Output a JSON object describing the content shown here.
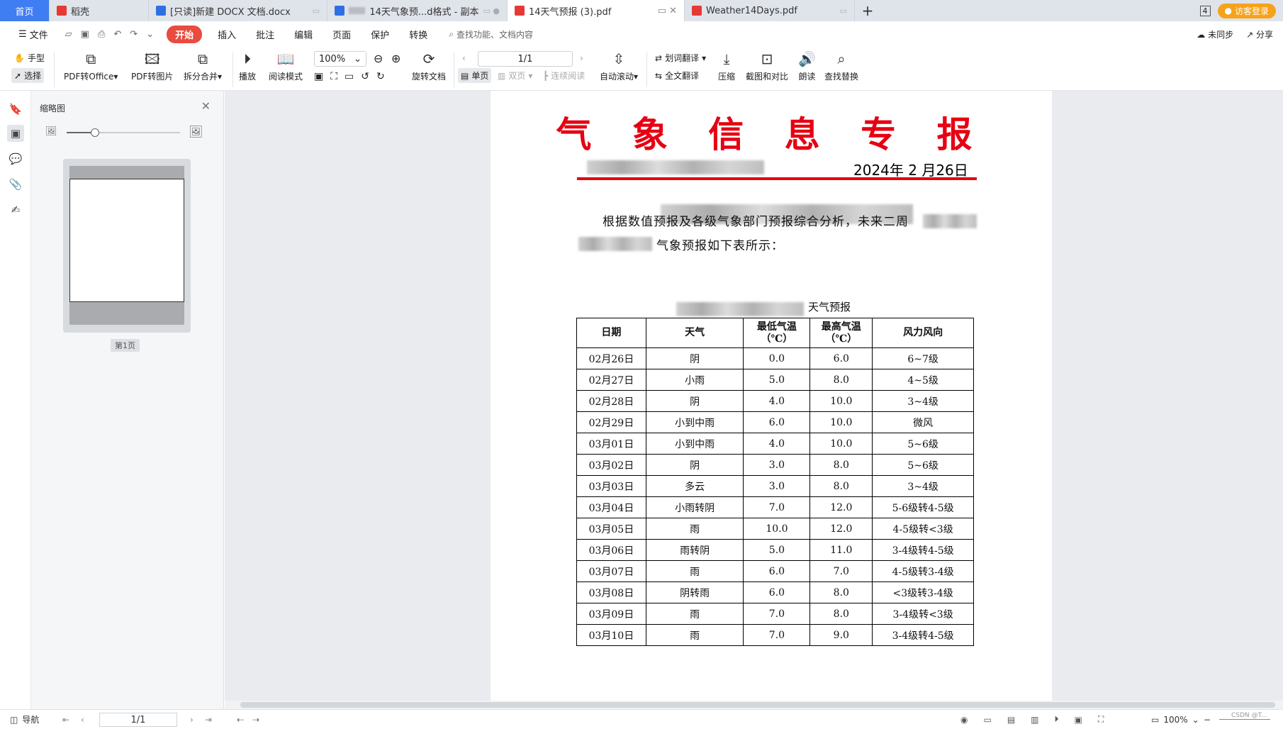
{
  "tabs": [
    {
      "label": "首页"
    },
    {
      "label": "稻壳"
    },
    {
      "label": "[只读]新建 DOCX 文档.docx"
    },
    {
      "label": "14天气象预...d格式 - 副本"
    },
    {
      "label": "14天气预报 (3).pdf"
    },
    {
      "label": "Weather14Days.pdf"
    }
  ],
  "tab_right": {
    "window_count": "4",
    "visitor_label": "访客登录"
  },
  "menu": {
    "file": "文件",
    "items": [
      "开始",
      "插入",
      "批注",
      "编辑",
      "页面",
      "保护",
      "转换"
    ],
    "search_placeholder": "查找功能、文档内容",
    "sync": "未同步",
    "share": "分享"
  },
  "toolbar": {
    "hand": "手型",
    "select": "选择",
    "pdf_to_office": "PDF转Office",
    "pdf_to_image": "PDF转图片",
    "split_merge": "拆分合并",
    "play": "播放",
    "reading_mode": "阅读模式",
    "zoom": "100%",
    "rotate_doc": "旋转文档",
    "page_value": "1/1",
    "single_page": "单页",
    "double_page": "双页",
    "continuous": "连续阅读",
    "auto_scroll": "自动滚动",
    "word_translate": "划词翻译",
    "full_translate": "全文翻译",
    "compress": "压缩",
    "screenshot_compare": "截图和对比",
    "read_aloud": "朗读",
    "find_replace": "查找替换"
  },
  "thumb_panel": {
    "title": "缩略图",
    "page_label": "第1页",
    "zoom_level": 0.25
  },
  "document": {
    "title": "气 象 信 息 专 报",
    "date": "2024年 2 月26日",
    "para1": "根据数值预报及各级气象部门预报综合分析，未来二周",
    "para2": "气象预报如下表所示：",
    "table_caption": "天气预报",
    "headers": [
      "日期",
      "天气",
      "最低气温\n（℃）",
      "最高气温\n（℃）",
      "风力风向"
    ],
    "rows": [
      [
        "02月26日",
        "阴",
        "0.0",
        "6.0",
        "6~7级"
      ],
      [
        "02月27日",
        "小雨",
        "5.0",
        "8.0",
        "4~5级"
      ],
      [
        "02月28日",
        "阴",
        "4.0",
        "10.0",
        "3~4级"
      ],
      [
        "02月29日",
        "小到中雨",
        "6.0",
        "10.0",
        "微风"
      ],
      [
        "03月01日",
        "小到中雨",
        "4.0",
        "10.0",
        "5~6级"
      ],
      [
        "03月02日",
        "阴",
        "3.0",
        "8.0",
        "5~6级"
      ],
      [
        "03月03日",
        "多云",
        "3.0",
        "8.0",
        "3~4级"
      ],
      [
        "03月04日",
        "小雨转阴",
        "7.0",
        "12.0",
        "5-6级转4-5级"
      ],
      [
        "03月05日",
        "雨",
        "10.0",
        "12.0",
        "4-5级转<3级"
      ],
      [
        "03月06日",
        "雨转阴",
        "5.0",
        "11.0",
        "3-4级转4-5级"
      ],
      [
        "03月07日",
        "雨",
        "6.0",
        "7.0",
        "4-5级转3-4级"
      ],
      [
        "03月08日",
        "阴转雨",
        "6.0",
        "8.0",
        "<3级转3-4级"
      ],
      [
        "03月09日",
        "雨",
        "7.0",
        "8.0",
        "3-4级转<3级"
      ],
      [
        "03月10日",
        "雨",
        "7.0",
        "9.0",
        "3-4级转4-5级"
      ]
    ]
  },
  "statusbar": {
    "nav": "导航",
    "page": "1/1",
    "zoom": "100%",
    "watermark": "CSDN @T..."
  },
  "colors": {
    "accent": "#3f7df2",
    "title_red": "#e60012",
    "start_btn": "#ea4b3f",
    "visitor": "#f7a21b"
  }
}
